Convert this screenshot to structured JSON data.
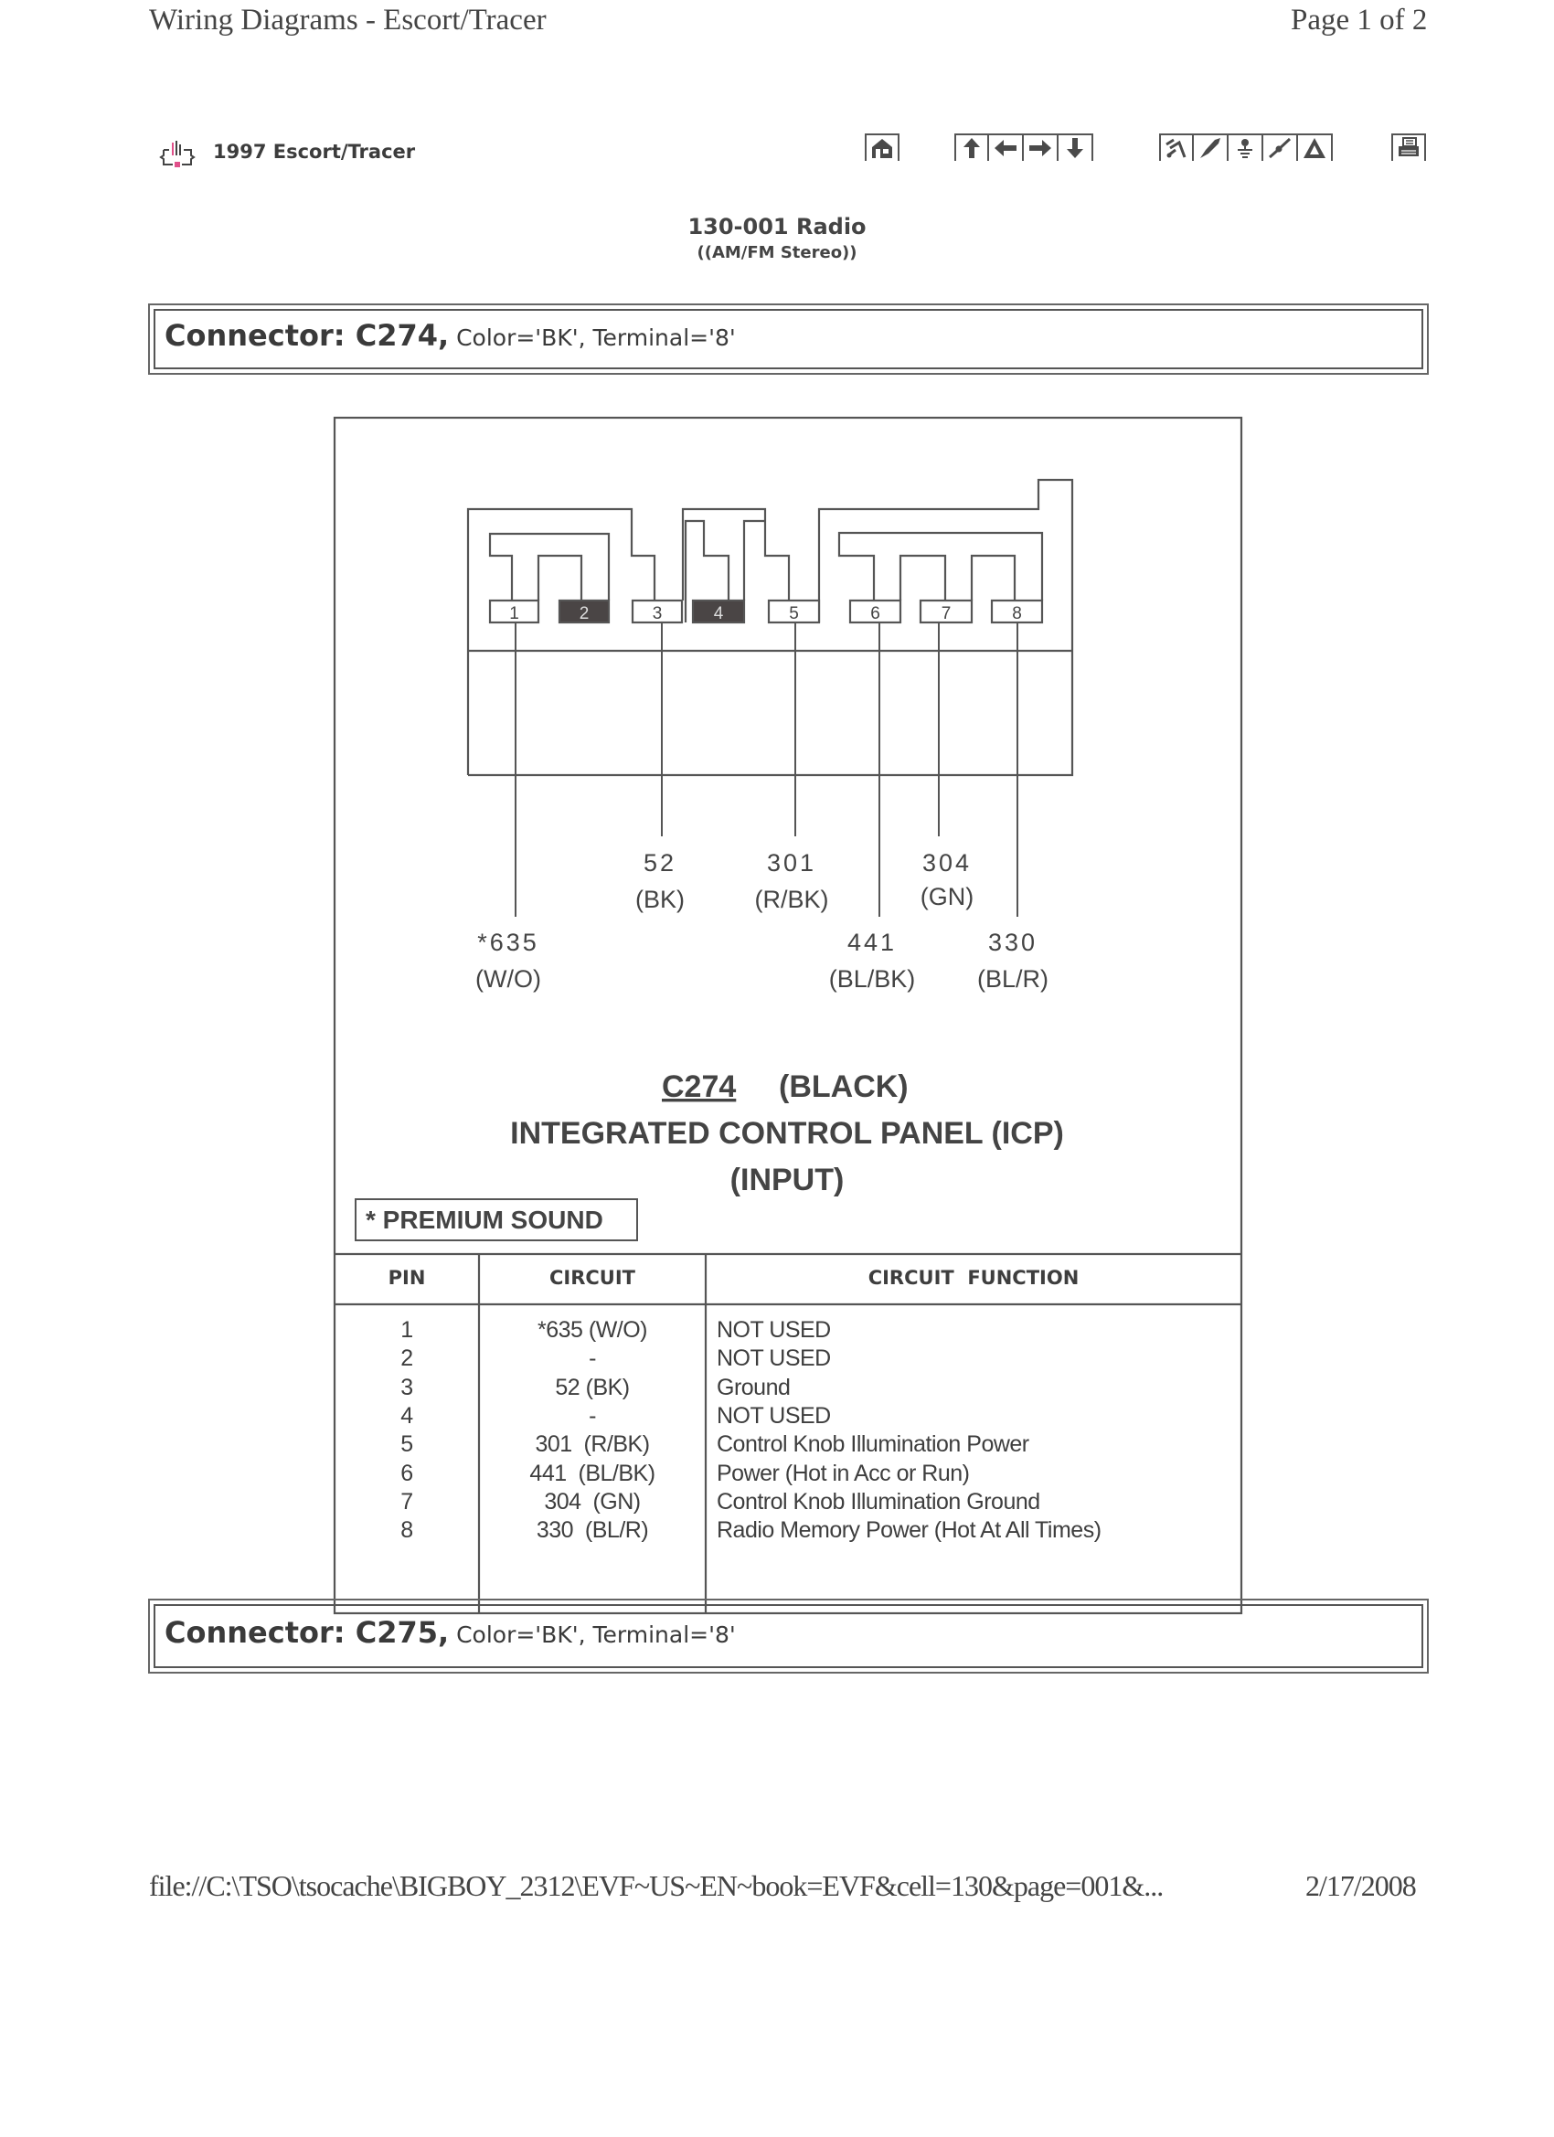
{
  "header": {
    "title": "Wiring Diagrams - Escort/Tracer",
    "page_indicator": "Page 1 of 2",
    "model": "1997 Escort/Tracer"
  },
  "toolbar": {
    "home": {
      "icon": "home-icon"
    },
    "navigation": [
      {
        "icon": "arrow-up-icon",
        "glyph": "⬆"
      },
      {
        "icon": "arrow-left-icon",
        "glyph": "⬅"
      },
      {
        "icon": "arrow-right-icon",
        "glyph": "➡"
      },
      {
        "icon": "arrow-down-icon",
        "glyph": "⬇"
      }
    ],
    "tools": [
      {
        "icon": "splice-icon"
      },
      {
        "icon": "probe-icon"
      },
      {
        "icon": "ground-icon"
      },
      {
        "icon": "wire-icon"
      },
      {
        "icon": "warning-triangle-icon"
      }
    ],
    "print": {
      "icon": "printer-icon"
    }
  },
  "section": {
    "title": "130-001 Radio",
    "subtitle": "((AM/FM Stereo))"
  },
  "connectors": [
    {
      "label": "Connector: C274,",
      "attrs": " Color='BK', Terminal='8'"
    },
    {
      "label": "Connector: C275,",
      "attrs": " Color='BK', Terminal='8'"
    }
  ],
  "diagram": {
    "connector_id": "C274",
    "connector_color": "(BLACK)",
    "component": "INTEGRATED CONTROL PANEL (ICP)",
    "side": "(INPUT)",
    "footnote": "* PREMIUM SOUND",
    "pins": [
      {
        "num": "1",
        "filled": false
      },
      {
        "num": "2",
        "filled": true
      },
      {
        "num": "3",
        "filled": false
      },
      {
        "num": "4",
        "filled": true
      },
      {
        "num": "5",
        "filled": false
      },
      {
        "num": "6",
        "filled": false
      },
      {
        "num": "7",
        "filled": false
      },
      {
        "num": "8",
        "filled": false
      }
    ],
    "wire_labels": [
      {
        "pin": "1",
        "circuit": "*635",
        "color": "(W/O)"
      },
      {
        "pin": "3",
        "circuit": "52",
        "color": "(BK)"
      },
      {
        "pin": "5",
        "circuit": "301",
        "color": "(R/BK)"
      },
      {
        "pin": "6",
        "circuit": "441",
        "color": "(BL/BK)"
      },
      {
        "pin": "7",
        "circuit": "304",
        "color": "(GN)"
      },
      {
        "pin": "8",
        "circuit": "330",
        "color": "(BL/R)"
      }
    ]
  },
  "table": {
    "headers": [
      "PIN",
      "CIRCUIT",
      "CIRCUIT  FUNCTION"
    ],
    "rows": [
      {
        "pin": "1",
        "circuit": "*635 (W/O)",
        "function": "NOT USED"
      },
      {
        "pin": "2",
        "circuit": "-",
        "function": "NOT USED"
      },
      {
        "pin": "3",
        "circuit": "52 (BK)",
        "function": "Ground"
      },
      {
        "pin": "4",
        "circuit": "-",
        "function": "NOT USED"
      },
      {
        "pin": "5",
        "circuit": "301  (R/BK)",
        "function": "Control Knob Illumination Power"
      },
      {
        "pin": "6",
        "circuit": "441  (BL/BK)",
        "function": "Power (Hot in Acc or Run)"
      },
      {
        "pin": "7",
        "circuit": "304  (GN)",
        "function": "Control Knob Illumination Ground"
      },
      {
        "pin": "8",
        "circuit": "330  (BL/R)",
        "function": "Radio Memory Power (Hot At All Times)"
      }
    ]
  },
  "footer": {
    "url": "file://C:\\TSO\\tsocache\\BIGBOY_2312\\EVF~US~EN~book=EVF&cell=130&page=001&...",
    "date": "2/17/2008"
  },
  "colors": {
    "ink": "#3a3a3a",
    "pin_fill": "#4a4545",
    "logo_accent": "#e0508a"
  }
}
